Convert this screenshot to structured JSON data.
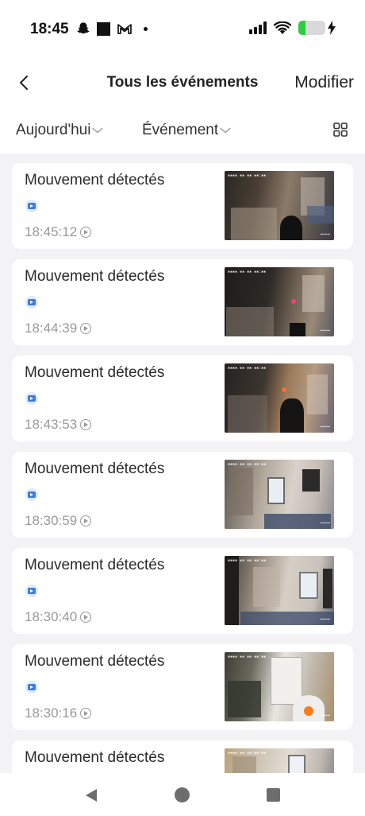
{
  "status_bar": {
    "time": "18:45",
    "icons_left": [
      "snapchat-ghost-icon",
      "square-icon",
      "gmail-icon",
      "dot-icon"
    ],
    "icons_right": [
      "signal-icon",
      "wifi-icon",
      "battery-icon",
      "charging-icon"
    ],
    "battery_level": 0.25,
    "battery_color": "#2ecc40"
  },
  "header": {
    "back_icon": "chevron-left-icon",
    "title": "Tous les événements",
    "modify_label": "Modifier"
  },
  "filters": {
    "date_label": "Aujourd'hui",
    "type_label": "Événement",
    "chevron_icon": "chevron-down-icon",
    "view_icon": "grid-view-icon"
  },
  "events": [
    {
      "title": "Mouvement détectés",
      "time": "18:45:12",
      "thumb_style": "dark-room"
    },
    {
      "title": "Mouvement détectés",
      "time": "18:44:39",
      "thumb_style": "dark-room"
    },
    {
      "title": "Mouvement détectés",
      "time": "18:43:53",
      "thumb_style": "dark-room"
    },
    {
      "title": "Mouvement détectés",
      "time": "18:30:59",
      "thumb_style": "bright-room"
    },
    {
      "title": "Mouvement détectés",
      "time": "18:30:40",
      "thumb_style": "bright-room"
    },
    {
      "title": "Mouvement détectés",
      "time": "18:30:16",
      "thumb_style": "close-up"
    },
    {
      "title": "Mouvement détectés",
      "time": "",
      "thumb_style": "bright-room"
    }
  ],
  "nav_bar": {
    "icons": [
      "nav-back-icon",
      "nav-home-icon",
      "nav-recents-icon"
    ]
  },
  "colors": {
    "accent_blue": "#3b7be8",
    "list_background": "#f3f3f5",
    "secondary_text": "#999999"
  }
}
